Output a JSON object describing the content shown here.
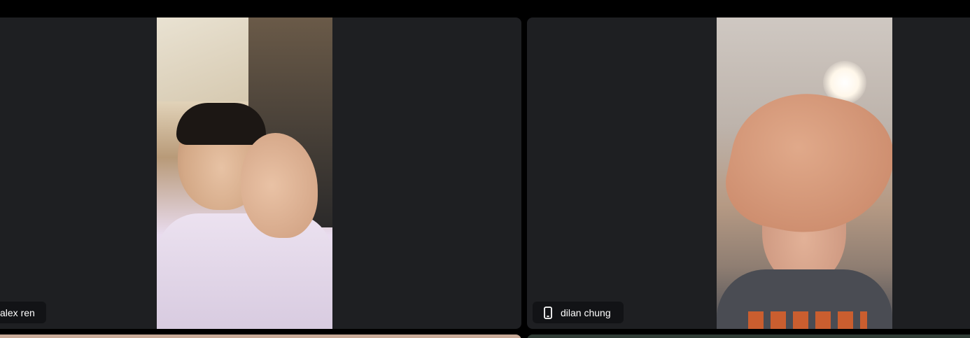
{
  "participants": [
    {
      "name": "alex ren",
      "device": "",
      "video": "camera-feed"
    },
    {
      "name": "dilan chung",
      "device": "mobile-phone-icon",
      "video": "camera-feed"
    }
  ],
  "colors": {
    "background": "#000000",
    "tile": "#1e1f22",
    "name_tag_bg": "#111214",
    "name_tag_text": "#ffffff"
  }
}
